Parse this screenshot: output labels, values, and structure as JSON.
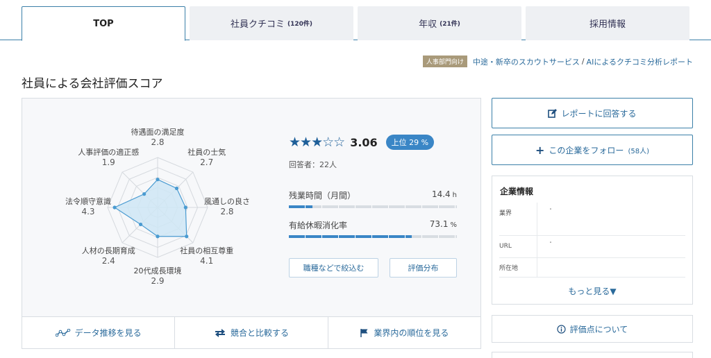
{
  "tabs": [
    {
      "label": "TOP",
      "count": ""
    },
    {
      "label": "社員クチコミ",
      "count": "(120件)"
    },
    {
      "label": "年収",
      "count": "(21件)"
    },
    {
      "label": "採用情報",
      "count": ""
    }
  ],
  "promo": {
    "badge": "人事部門向け",
    "link1": "中途・新卒のスカウトサービス",
    "divider": "/",
    "link2": "AIによるクチコミ分析レポート"
  },
  "section_title": "社員による会社評価スコア",
  "radar": {
    "max": 5,
    "axes": [
      {
        "label": "待遇面の満足度",
        "value": "2.8",
        "score": 2.8
      },
      {
        "label": "社員の士気",
        "value": "2.7",
        "score": 2.7
      },
      {
        "label": "風通しの良さ",
        "value": "2.8",
        "score": 2.8
      },
      {
        "label": "社員の相互尊重",
        "value": "4.1",
        "score": 4.1
      },
      {
        "label": "20代成長環境",
        "value": "2.9",
        "score": 2.9
      },
      {
        "label": "人材の長期育成",
        "value": "2.4",
        "score": 2.4
      },
      {
        "label": "法令順守意識",
        "value": "4.3",
        "score": 4.3
      },
      {
        "label": "人事評価の適正感",
        "value": "1.9",
        "score": 1.9
      }
    ],
    "colors": {
      "fill": "#cfe6f5",
      "stroke": "#4a9bd1",
      "grid": "#d5d9de"
    }
  },
  "summary": {
    "stars_filled": "★★★",
    "stars_empty": "☆☆",
    "score": "3.06",
    "rank": "上位 29 %",
    "respondents": "回答者：22人"
  },
  "metrics": [
    {
      "label": "残業時間（月間）",
      "value": "14.4",
      "unit": "h",
      "fill_fraction": 0.14
    },
    {
      "label": "有給休暇消化率",
      "value": "73.1",
      "unit": "%",
      "fill_fraction": 0.731
    }
  ],
  "buttons": {
    "filter": "職種などで絞込む",
    "distribution": "評価分布"
  },
  "footer": [
    {
      "label": "データ推移を見る",
      "icon": "trend-line-icon"
    },
    {
      "label": "競合と比較する",
      "icon": "compare-arrows-icon"
    },
    {
      "label": "業界内の順位を見る",
      "icon": "flag-icon"
    }
  ],
  "side": {
    "answer_report": "レポートに回答する",
    "follow": "この企業をフォロー",
    "follow_count": "(58人)",
    "info_title": "企業情報",
    "info_rows": [
      {
        "key": "業界",
        "value": "・"
      },
      {
        "key": "URL",
        "value": "・"
      },
      {
        "key": "所在地",
        "value": ""
      }
    ],
    "more": "もっと見る▼",
    "about": "評価点について"
  }
}
